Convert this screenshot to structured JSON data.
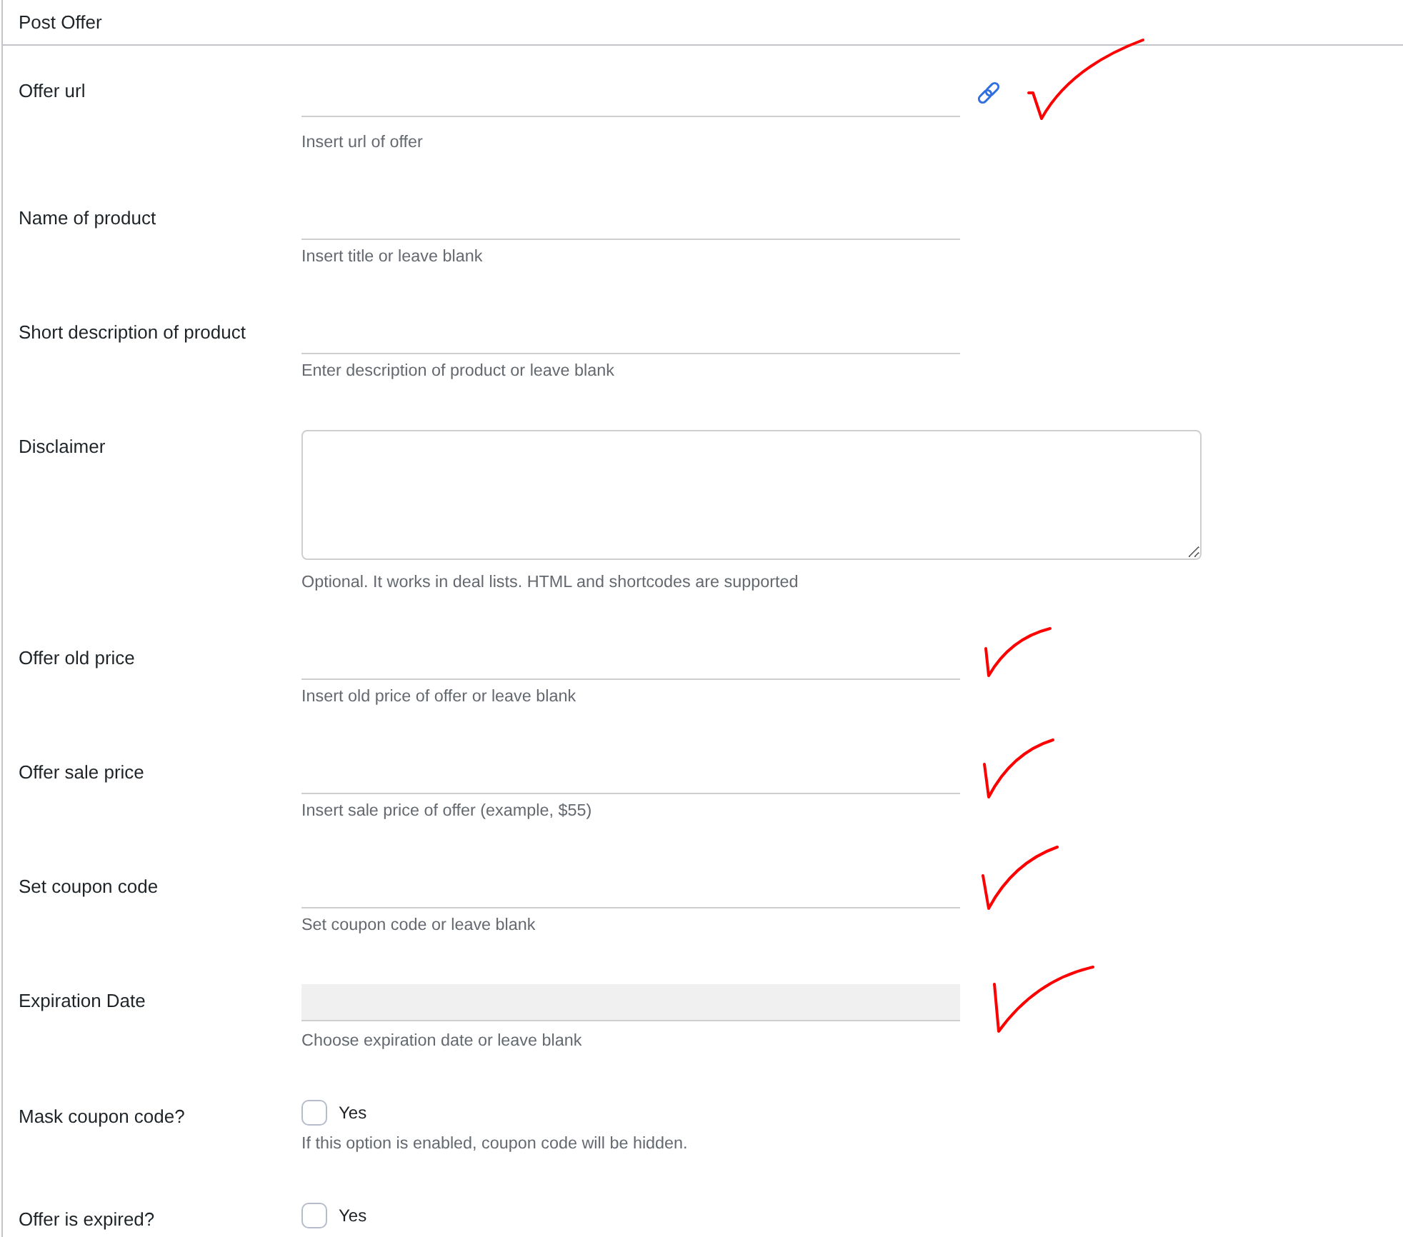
{
  "panel": {
    "title": "Post Offer"
  },
  "fields": [
    {
      "kind": "url",
      "label": "Offer url",
      "help": "Insert url of offer",
      "ticked": true
    },
    {
      "kind": "text",
      "label": "Name of product",
      "help": "Insert title or leave blank",
      "ticked": false
    },
    {
      "kind": "text",
      "label": "Short description of product",
      "help": "Enter description of product or leave blank",
      "ticked": false
    },
    {
      "kind": "textarea",
      "label": "Disclaimer",
      "help": "Optional. It works in deal lists. HTML and shortcodes are supported",
      "ticked": false
    },
    {
      "kind": "text",
      "label": "Offer old price",
      "help": "Insert old price of offer or leave blank",
      "ticked": true
    },
    {
      "kind": "text",
      "label": "Offer sale price",
      "help": "Insert sale price of offer (example, $55)",
      "ticked": true
    },
    {
      "kind": "text",
      "label": "Set coupon code",
      "help": "Set coupon code or leave blank",
      "ticked": true
    },
    {
      "kind": "date",
      "label": "Expiration Date",
      "help": "Choose expiration date or leave blank",
      "ticked": true
    },
    {
      "kind": "checkbox",
      "label": "Mask coupon code?",
      "option": "Yes",
      "checked": false,
      "help": "If this option is enabled, coupon code will be hidden.",
      "ticked": false
    },
    {
      "kind": "checkbox",
      "label": "Offer is expired?",
      "option": "Yes",
      "checked": false,
      "ticked": false
    }
  ]
}
